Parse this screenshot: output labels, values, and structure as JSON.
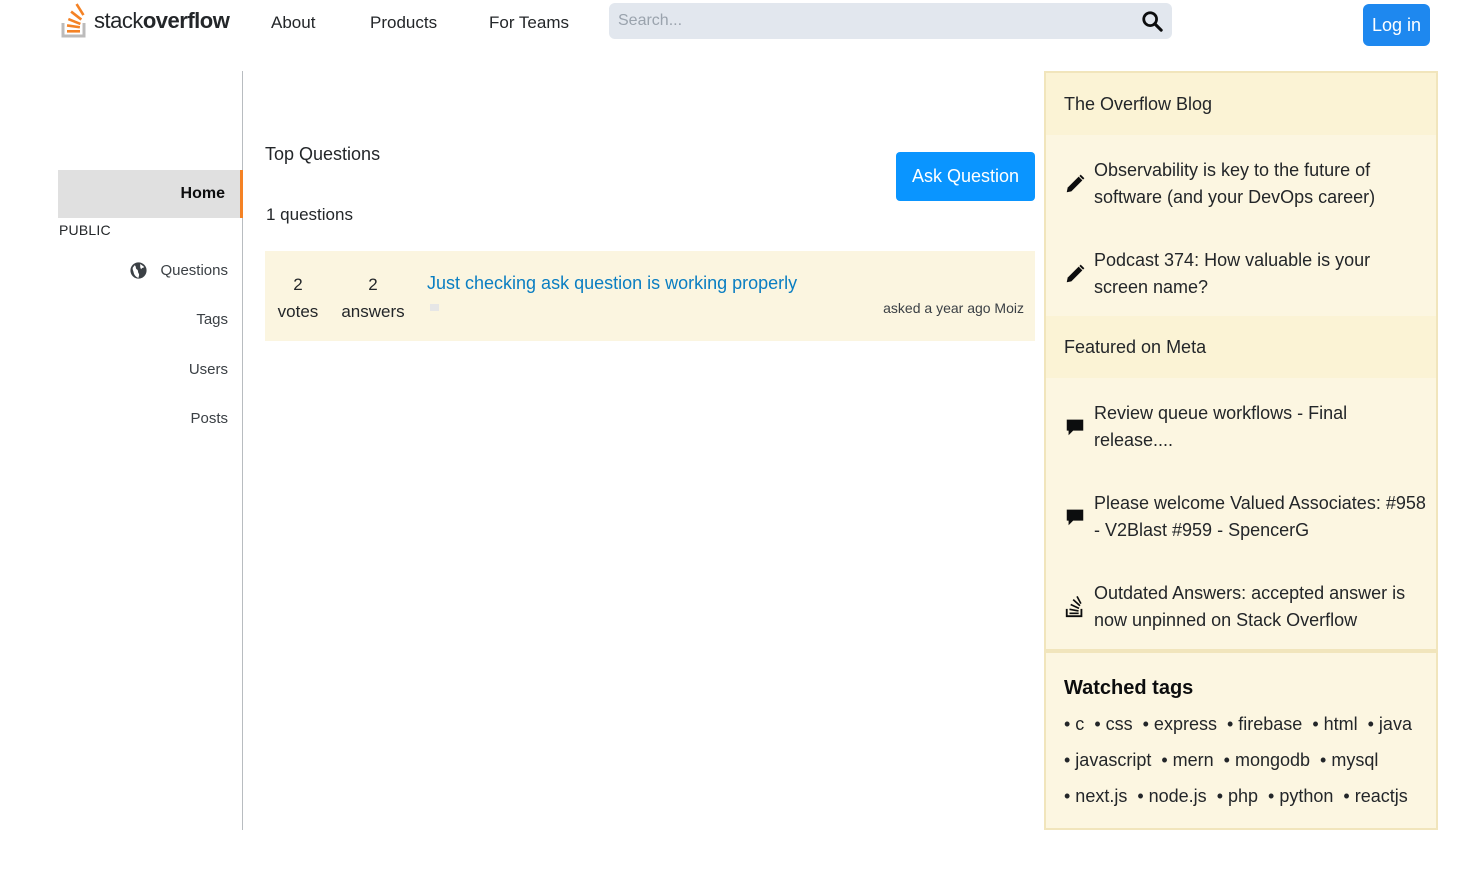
{
  "header": {
    "logo": {
      "word_light": "stack",
      "word_bold": "overflow"
    },
    "nav": [
      "About",
      "Products",
      "For Teams"
    ],
    "search": {
      "placeholder": "Search...",
      "value": ""
    },
    "login_label": "Log in",
    "colors": {
      "login": "#1e88ef",
      "brand": "#f48225"
    }
  },
  "sidebar": {
    "home_label": "Home",
    "public_label": "PUBLIC",
    "items": [
      {
        "label": "Questions",
        "icon": "globe-icon"
      },
      {
        "label": "Tags"
      },
      {
        "label": "Users"
      },
      {
        "label": "Posts"
      }
    ]
  },
  "main": {
    "title": "Top Questions",
    "ask_label": "Ask Question",
    "count_text": "1 questions",
    "questions": [
      {
        "votes": "2",
        "votes_label": "votes",
        "answers": "2",
        "answers_label": "answers",
        "title": "Just checking ask question is working properly",
        "meta": "asked a year ago Moiz"
      }
    ]
  },
  "right": {
    "blog_heading": "The Overflow Blog",
    "blog_items": [
      {
        "icon": "pencil-icon",
        "text": "Observability is key to the future of software (and your DevOps career)"
      },
      {
        "icon": "pencil-icon",
        "text": "Podcast 374: How valuable is your screen name?"
      }
    ],
    "meta_heading": "Featured on Meta",
    "meta_items": [
      {
        "icon": "comment-icon",
        "text": "Review queue workflows - Final release...."
      },
      {
        "icon": "comment-icon",
        "text": "Please welcome Valued Associates: #958 - V2Blast #959 - SpencerG"
      },
      {
        "icon": "stack-overflow-icon",
        "text": "Outdated Answers: accepted answer is now unpinned on Stack Overflow"
      }
    ],
    "watched_title": "Watched tags",
    "tags": [
      "• c",
      "• css",
      "• express",
      "• firebase",
      "• html",
      "• java",
      "• javascript",
      "• mern",
      "• mongodb",
      "• mysql",
      "• next.js",
      "• node.js",
      "• php",
      "• python",
      "• reactjs"
    ]
  }
}
